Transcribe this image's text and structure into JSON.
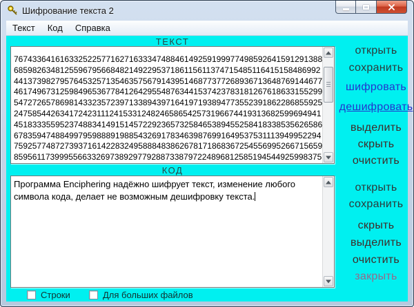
{
  "window": {
    "title": "Шифрование текста 2"
  },
  "menu": {
    "items": [
      "Текст",
      "Код",
      "Справка"
    ]
  },
  "text_section": {
    "label": "ТЕКСТ",
    "lines": [
      "7674336416163325225771627163334748846149259199977498592641591291388",
      "6859826348125596795668482149229537186115611374715485116415158486992",
      "4413739827957645325713546357567914395146877377268936713648769144677",
      "4617496731259849653677841264295548763441537423783181267618633155299",
      "5472726578698143323572397133894397164197193894773552391862286855925",
      "2475854426341724231112415331248246586542573196674419313682599694941",
      "4518333559523748834149151457229236573258465389455258418338535626586",
      "6783594748849979598889198854326917834639876991649537531113949952294",
      "7592577487273937161422832495888483862678171868367254556995266715659",
      "8595611739995566332697389297792887338797224896812585194544925998375"
    ]
  },
  "code_section": {
    "label": "КОД",
    "lines": [
      "Программа Enciphering надёжно шифрует текст, изменение любого",
      "символа кода, делает не возможным дешифровку текста."
    ]
  },
  "sidebar": {
    "group1": [
      "открыть",
      "сохранить",
      "шифровать",
      "дешифровать",
      "выделить",
      "скрыть",
      "очистить"
    ],
    "group2": [
      "открыть",
      "сохранить",
      "скрыть",
      "выделить",
      "очистить",
      "закрыть"
    ]
  },
  "checkboxes": [
    {
      "label": "Строки",
      "checked": false
    },
    {
      "label": "Для больших файлов",
      "checked": false
    }
  ],
  "colors": {
    "client_background": "#00f0f0",
    "action_default": "#2c3a3a",
    "action_encrypt_blue": "#2334cc",
    "action_maroon": "#402b28",
    "action_close_mauve": "#97698a",
    "close_button_red": "#cf5134"
  }
}
